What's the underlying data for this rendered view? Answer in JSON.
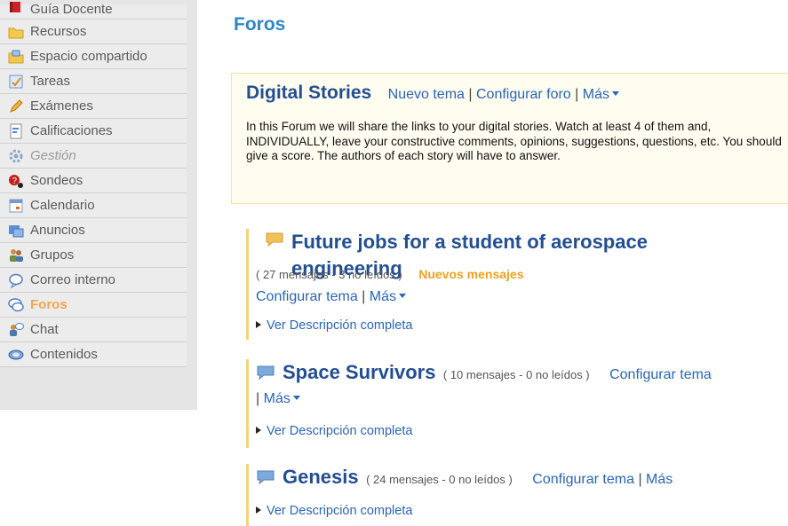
{
  "sidebar": {
    "items": [
      {
        "label": "Guía Docente",
        "icon": "book-icon"
      },
      {
        "label": "Recursos",
        "icon": "folder-icon"
      },
      {
        "label": "Espacio compartido",
        "icon": "shared-folder-icon"
      },
      {
        "label": "Tareas",
        "icon": "tasks-icon"
      },
      {
        "label": "Exámenes",
        "icon": "pencil-icon"
      },
      {
        "label": "Calificaciones",
        "icon": "grades-icon"
      },
      {
        "label": "Gestión",
        "icon": "gear-icon"
      },
      {
        "label": "Sondeos",
        "icon": "poll-icon"
      },
      {
        "label": "Calendario",
        "icon": "calendar-icon"
      },
      {
        "label": "Anuncios",
        "icon": "announcements-icon"
      },
      {
        "label": "Grupos",
        "icon": "groups-icon"
      },
      {
        "label": "Correo interno",
        "icon": "mail-bubble-icon"
      },
      {
        "label": "Foros",
        "icon": "forum-icon"
      },
      {
        "label": "Chat",
        "icon": "chat-icon"
      },
      {
        "label": "Contenidos",
        "icon": "contents-icon"
      }
    ],
    "active": "Foros",
    "disabled": "Gestión"
  },
  "page": {
    "title": "Foros"
  },
  "forum": {
    "title": "Digital Stories",
    "new_topic": "Nuevo tema",
    "configure": "Configurar foro",
    "more": "Más",
    "separator": "|",
    "description": "In this Forum we will share the links to your digital stories. Watch at least 4 of them and, INDIVIDUALLY, leave your constructive comments, opinions, suggestions, questions, etc. You should give a score. The authors of each story will have to answer."
  },
  "topics": [
    {
      "title": "Future jobs for a student of aerospace engineering",
      "counts": "( 27 mensajes - 3 no leídos )",
      "new_label": "Nuevos mensajes",
      "configure": "Configurar tema",
      "more": "Más",
      "desc_toggle": "Ver Descripción completa",
      "bubble_color": "#f3c15a"
    },
    {
      "title": "Space Survivors",
      "counts": "( 10 mensajes - 0 no leídos )",
      "configure": "Configurar tema",
      "more": "Más",
      "desc_toggle": "Ver Descripción completa",
      "bubble_color": "#7fa9d9"
    },
    {
      "title": "Genesis",
      "counts": "( 24 mensajes - 0 no leídos )",
      "configure": "Configurar tema",
      "more": "Más",
      "desc_toggle": "Ver Descripción completa",
      "bubble_color": "#7fa9d9"
    }
  ],
  "colors": {
    "accent": "#2f85c6",
    "link": "#2a65b4",
    "title": "#234e91",
    "new": "#f0a020",
    "active_nav": "#f0a650"
  }
}
